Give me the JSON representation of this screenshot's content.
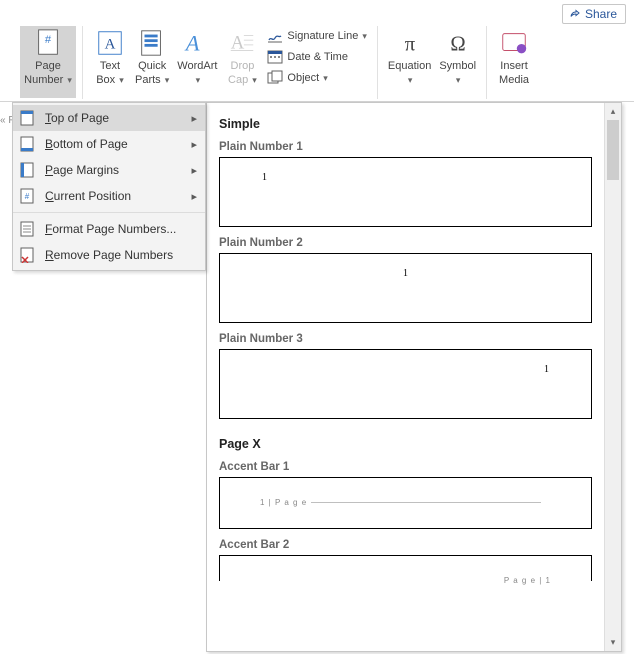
{
  "share": {
    "label": "Share"
  },
  "ribbon": {
    "pageNumber": {
      "line1": "Page",
      "line2": "Number"
    },
    "textBox": {
      "line1": "Text",
      "line2": "Box"
    },
    "quickParts": {
      "line1": "Quick",
      "line2": "Parts"
    },
    "wordart": {
      "line1": "WordArt"
    },
    "dropCap": {
      "line1": "Drop",
      "line2": "Cap"
    },
    "sigLine": "Signature Line",
    "dateTime": "Date & Time",
    "object": "Object",
    "equation": {
      "line1": "Equation"
    },
    "symbol": {
      "line1": "Symbol"
    },
    "insertMedia": {
      "line1": "Insert",
      "line2": "Media"
    }
  },
  "pnMenu": {
    "top": "op of Page",
    "bottom": "ottom of Page",
    "margins": "age Margins",
    "current": "urrent Position",
    "format": "ormat Page Numbers...",
    "remove": "emove Page Numbers"
  },
  "gallery": {
    "section1": "Simple",
    "p1": "Plain Number 1",
    "p2": "Plain Number 2",
    "p3": "Plain Number 3",
    "section2": "Page X",
    "a1": "Accent Bar 1",
    "a2": "Accent Bar 2",
    "num": "1",
    "accentText": "1 | P a g e",
    "accentText2": "P a g e  | 1"
  },
  "ruler": "« F"
}
